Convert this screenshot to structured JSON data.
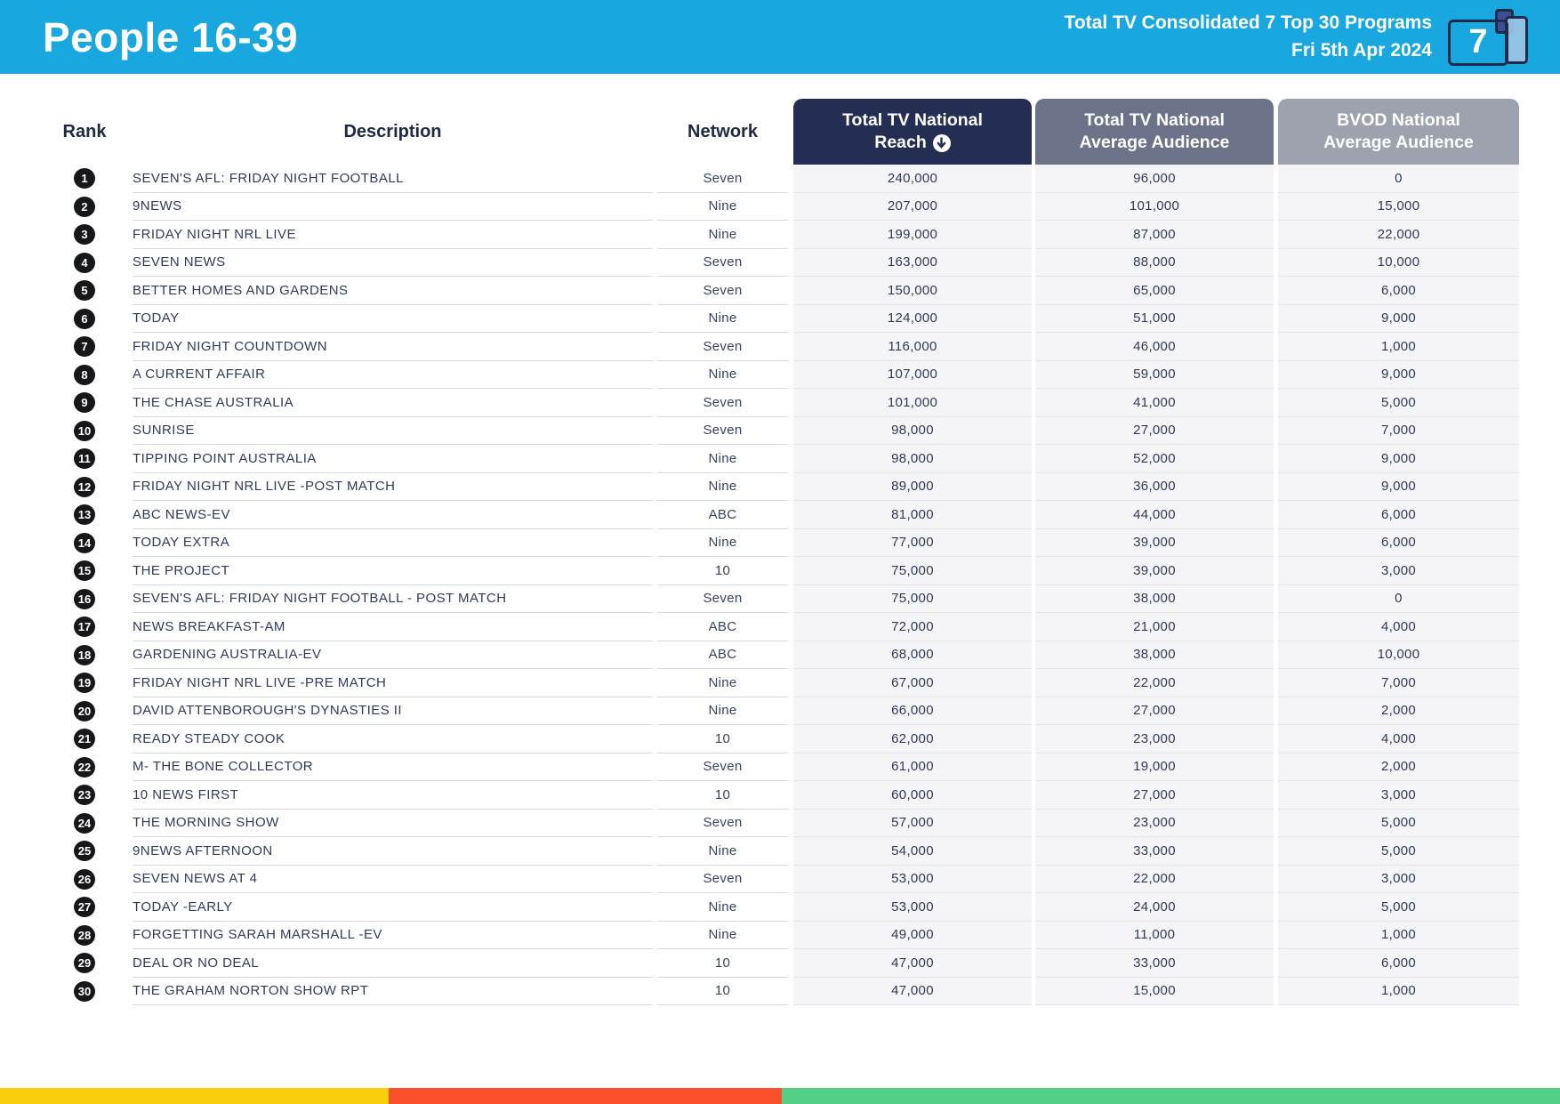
{
  "page": {
    "title": "People 16-39",
    "report_title": "Total TV Consolidated 7 Top 30 Programs",
    "report_date": "Fri 5th Apr 2024",
    "logo_number": "7"
  },
  "colors": {
    "banner": "#19A7E0",
    "reach_header_bg": "#242E52",
    "avg_header_bg": "#6C7287",
    "bvod_header_bg": "#9EA2AF",
    "rank_badge": "#15171B",
    "footer_yellow": "#F9CE0D",
    "footer_red": "#F9502B",
    "footer_green": "#54CF87"
  },
  "table": {
    "columns": {
      "rank": "Rank",
      "description": "Description",
      "network": "Network",
      "reach_line1": "Total TV National",
      "reach_line2": "Reach",
      "reach_sort_icon": "circle-down-arrow",
      "avg_line1": "Total TV National",
      "avg_line2": "Average Audience",
      "bvod_line1": "BVOD National",
      "bvod_line2": "Average Audience"
    },
    "rows": [
      {
        "rank": "1",
        "description": "SEVEN'S AFL: FRIDAY NIGHT FOOTBALL",
        "network": "Seven",
        "reach": "240,000",
        "avg": "96,000",
        "bvod": "0"
      },
      {
        "rank": "2",
        "description": "9NEWS",
        "network": "Nine",
        "reach": "207,000",
        "avg": "101,000",
        "bvod": "15,000"
      },
      {
        "rank": "3",
        "description": "FRIDAY NIGHT NRL LIVE",
        "network": "Nine",
        "reach": "199,000",
        "avg": "87,000",
        "bvod": "22,000"
      },
      {
        "rank": "4",
        "description": "SEVEN NEWS",
        "network": "Seven",
        "reach": "163,000",
        "avg": "88,000",
        "bvod": "10,000"
      },
      {
        "rank": "5",
        "description": "BETTER HOMES AND GARDENS",
        "network": "Seven",
        "reach": "150,000",
        "avg": "65,000",
        "bvod": "6,000"
      },
      {
        "rank": "6",
        "description": "TODAY",
        "network": "Nine",
        "reach": "124,000",
        "avg": "51,000",
        "bvod": "9,000"
      },
      {
        "rank": "7",
        "description": "FRIDAY NIGHT COUNTDOWN",
        "network": "Seven",
        "reach": "116,000",
        "avg": "46,000",
        "bvod": "1,000"
      },
      {
        "rank": "8",
        "description": "A CURRENT AFFAIR",
        "network": "Nine",
        "reach": "107,000",
        "avg": "59,000",
        "bvod": "9,000"
      },
      {
        "rank": "9",
        "description": "THE CHASE AUSTRALIA",
        "network": "Seven",
        "reach": "101,000",
        "avg": "41,000",
        "bvod": "5,000"
      },
      {
        "rank": "10",
        "description": "SUNRISE",
        "network": "Seven",
        "reach": "98,000",
        "avg": "27,000",
        "bvod": "7,000"
      },
      {
        "rank": "11",
        "description": "TIPPING POINT AUSTRALIA",
        "network": "Nine",
        "reach": "98,000",
        "avg": "52,000",
        "bvod": "9,000"
      },
      {
        "rank": "12",
        "description": "FRIDAY NIGHT NRL LIVE -POST MATCH",
        "network": "Nine",
        "reach": "89,000",
        "avg": "36,000",
        "bvod": "9,000"
      },
      {
        "rank": "13",
        "description": "ABC NEWS-EV",
        "network": "ABC",
        "reach": "81,000",
        "avg": "44,000",
        "bvod": "6,000"
      },
      {
        "rank": "14",
        "description": "TODAY EXTRA",
        "network": "Nine",
        "reach": "77,000",
        "avg": "39,000",
        "bvod": "6,000"
      },
      {
        "rank": "15",
        "description": "THE PROJECT",
        "network": "10",
        "reach": "75,000",
        "avg": "39,000",
        "bvod": "3,000"
      },
      {
        "rank": "16",
        "description": "SEVEN'S AFL: FRIDAY NIGHT FOOTBALL - POST MATCH",
        "network": "Seven",
        "reach": "75,000",
        "avg": "38,000",
        "bvod": "0"
      },
      {
        "rank": "17",
        "description": "NEWS BREAKFAST-AM",
        "network": "ABC",
        "reach": "72,000",
        "avg": "21,000",
        "bvod": "4,000"
      },
      {
        "rank": "18",
        "description": "GARDENING AUSTRALIA-EV",
        "network": "ABC",
        "reach": "68,000",
        "avg": "38,000",
        "bvod": "10,000"
      },
      {
        "rank": "19",
        "description": "FRIDAY NIGHT NRL LIVE -PRE MATCH",
        "network": "Nine",
        "reach": "67,000",
        "avg": "22,000",
        "bvod": "7,000"
      },
      {
        "rank": "20",
        "description": "DAVID ATTENBOROUGH'S DYNASTIES II",
        "network": "Nine",
        "reach": "66,000",
        "avg": "27,000",
        "bvod": "2,000"
      },
      {
        "rank": "21",
        "description": "READY STEADY COOK",
        "network": "10",
        "reach": "62,000",
        "avg": "23,000",
        "bvod": "4,000"
      },
      {
        "rank": "22",
        "description": "M- THE BONE COLLECTOR",
        "network": "Seven",
        "reach": "61,000",
        "avg": "19,000",
        "bvod": "2,000"
      },
      {
        "rank": "23",
        "description": "10 NEWS FIRST",
        "network": "10",
        "reach": "60,000",
        "avg": "27,000",
        "bvod": "3,000"
      },
      {
        "rank": "24",
        "description": "THE MORNING SHOW",
        "network": "Seven",
        "reach": "57,000",
        "avg": "23,000",
        "bvod": "5,000"
      },
      {
        "rank": "25",
        "description": "9NEWS AFTERNOON",
        "network": "Nine",
        "reach": "54,000",
        "avg": "33,000",
        "bvod": "5,000"
      },
      {
        "rank": "26",
        "description": "SEVEN NEWS AT 4",
        "network": "Seven",
        "reach": "53,000",
        "avg": "22,000",
        "bvod": "3,000"
      },
      {
        "rank": "27",
        "description": "TODAY -EARLY",
        "network": "Nine",
        "reach": "53,000",
        "avg": "24,000",
        "bvod": "5,000"
      },
      {
        "rank": "28",
        "description": "FORGETTING SARAH MARSHALL -EV",
        "network": "Nine",
        "reach": "49,000",
        "avg": "11,000",
        "bvod": "1,000"
      },
      {
        "rank": "29",
        "description": "DEAL OR NO DEAL",
        "network": "10",
        "reach": "47,000",
        "avg": "33,000",
        "bvod": "6,000"
      },
      {
        "rank": "30",
        "description": "THE GRAHAM NORTON SHOW RPT",
        "network": "10",
        "reach": "47,000",
        "avg": "15,000",
        "bvod": "1,000"
      }
    ]
  },
  "footer": {
    "segments": [
      {
        "name": "yellow",
        "color": "#F9CE0D",
        "width_pct": 24.9
      },
      {
        "name": "red",
        "color": "#F9502B",
        "width_pct": 25.2
      },
      {
        "name": "green",
        "color": "#54CF87",
        "width_pct": 49.9
      }
    ]
  }
}
